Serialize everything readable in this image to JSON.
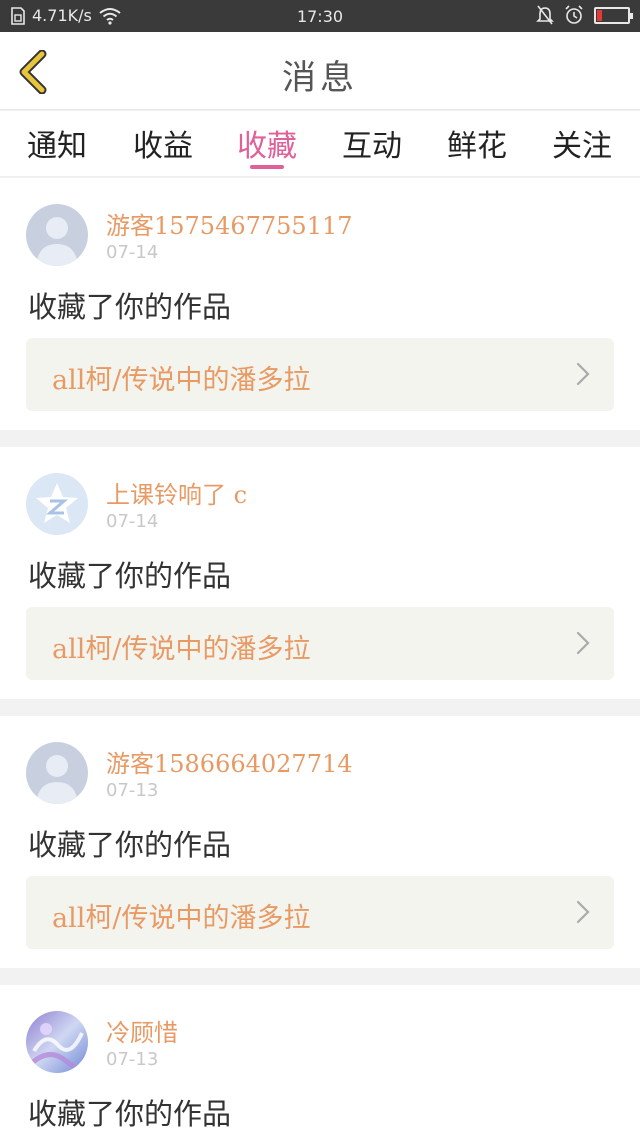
{
  "status_bar": {
    "net_speed": "4.71K/s",
    "time": "17:30",
    "icons": [
      "sim-icon",
      "wifi-icon",
      "mute-bell-icon",
      "alarm-icon",
      "battery-icon"
    ],
    "battery_level": 0.15,
    "battery_color": "#e53935"
  },
  "header": {
    "title": "消息",
    "back_icon": "chevron-left-icon",
    "back_color": "#e8c53a"
  },
  "tabs": [
    {
      "label": "通知"
    },
    {
      "label": "收益"
    },
    {
      "label": "收藏",
      "active": true
    },
    {
      "label": "互动"
    },
    {
      "label": "鲜花"
    },
    {
      "label": "关注"
    }
  ],
  "accent_color": "#e0609a",
  "items": [
    {
      "username": "游客1575467755117",
      "date": "07-14",
      "action": "收藏了你的作品",
      "work": "all柯/传说中的潘多拉",
      "avatar": "default-avatar"
    },
    {
      "username": "上课铃响了 c",
      "date": "07-14",
      "action": "收藏了你的作品",
      "work": "all柯/传说中的潘多拉",
      "avatar": "qzone-avatar"
    },
    {
      "username": "游客1586664027714",
      "date": "07-13",
      "action": "收藏了你的作品",
      "work": "all柯/传说中的潘多拉",
      "avatar": "default-avatar"
    },
    {
      "username": "冷顾惜",
      "date": "07-13",
      "action": "收藏了你的作品",
      "work": "",
      "avatar": "photo-avatar"
    }
  ]
}
